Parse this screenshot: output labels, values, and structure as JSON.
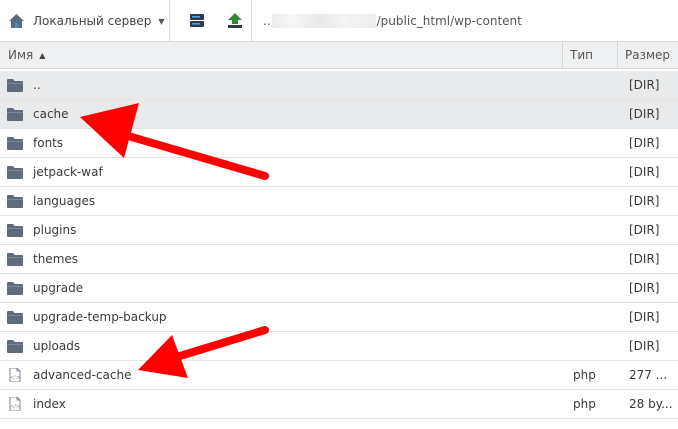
{
  "toolbar": {
    "server_label": "Локальный сервер",
    "path_prefix": "..",
    "path_suffix": "/public_html/wp-content"
  },
  "columns": {
    "name": "Имя",
    "type": "Тип",
    "size": "Размер"
  },
  "rows": [
    {
      "name": "..",
      "type": "",
      "size": "[DIR]",
      "kind": "folder",
      "selected": true
    },
    {
      "name": "cache",
      "type": "",
      "size": "[DIR]",
      "kind": "folder",
      "selected": true
    },
    {
      "name": "fonts",
      "type": "",
      "size": "[DIR]",
      "kind": "folder",
      "selected": false
    },
    {
      "name": "jetpack-waf",
      "type": "",
      "size": "[DIR]",
      "kind": "folder",
      "selected": false
    },
    {
      "name": "languages",
      "type": "",
      "size": "[DIR]",
      "kind": "folder",
      "selected": false
    },
    {
      "name": "plugins",
      "type": "",
      "size": "[DIR]",
      "kind": "folder",
      "selected": false
    },
    {
      "name": "themes",
      "type": "",
      "size": "[DIR]",
      "kind": "folder",
      "selected": false
    },
    {
      "name": "upgrade",
      "type": "",
      "size": "[DIR]",
      "kind": "folder",
      "selected": false
    },
    {
      "name": "upgrade-temp-backup",
      "type": "",
      "size": "[DIR]",
      "kind": "folder",
      "selected": false
    },
    {
      "name": "uploads",
      "type": "",
      "size": "[DIR]",
      "kind": "folder",
      "selected": false
    },
    {
      "name": "advanced-cache",
      "type": "php",
      "size": "277 ...",
      "kind": "file",
      "selected": false
    },
    {
      "name": "index",
      "type": "php",
      "size": "28 by...",
      "kind": "file",
      "selected": false
    }
  ],
  "colors": {
    "arrow": "#ff0000",
    "icon": "#5f6b7a",
    "upload": "#2e8b3a"
  }
}
